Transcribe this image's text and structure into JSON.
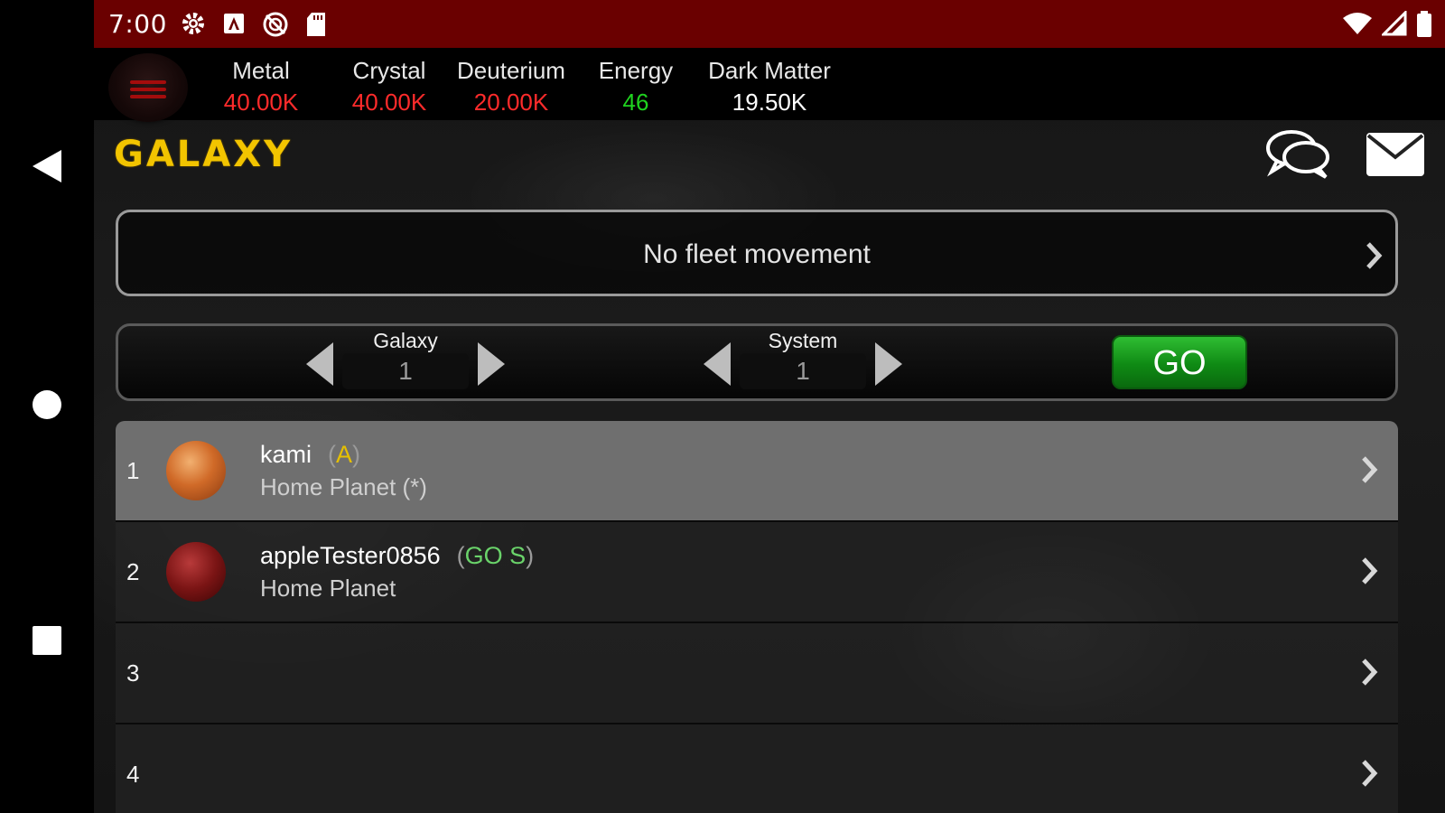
{
  "status_bar": {
    "time": "7:00",
    "left_icons": [
      "gear-icon",
      "a-box-icon",
      "no-sync-icon",
      "sd-card-icon"
    ],
    "right_icons": [
      "wifi-icon",
      "signal-icon",
      "battery-icon"
    ]
  },
  "android_nav": {
    "icons": [
      "back-triangle-icon",
      "home-circle-icon",
      "recents-square-icon"
    ]
  },
  "resources": [
    {
      "label": "Metal",
      "value": "40.00K",
      "color": "#ff2b2b"
    },
    {
      "label": "Crystal",
      "value": "40.00K",
      "color": "#ff2b2b"
    },
    {
      "label": "Deuterium",
      "value": "20.00K",
      "color": "#ff2b2b"
    },
    {
      "label": "Energy",
      "value": "46",
      "color": "#1fd31f"
    },
    {
      "label": "Dark Matter",
      "value": "19.50K",
      "color": "#ffffff"
    }
  ],
  "header": {
    "title": "Galaxy",
    "icons": [
      "chat-icon",
      "mail-icon"
    ],
    "title_color": "#f2c400"
  },
  "fleet": {
    "text": "No fleet movement"
  },
  "navigator": {
    "galaxy_label": "Galaxy",
    "galaxy_value": "1",
    "system_label": "System",
    "system_value": "1",
    "go_label": "GO"
  },
  "positions": [
    {
      "number": "1",
      "player": "kami",
      "tag_open": "(",
      "tag": "A",
      "tag_close": ")",
      "tag_color": "#e6c000",
      "planet": "Home Planet (*)",
      "planet_style": "orange"
    },
    {
      "number": "2",
      "player": "appleTester0856",
      "tag_open": "(",
      "tag": "GO S",
      "tag_close": ")",
      "tag_color": "#6ad36a",
      "planet": "Home Planet",
      "planet_style": "red"
    },
    {
      "number": "3",
      "player": "",
      "tag": "",
      "planet": ""
    },
    {
      "number": "4",
      "player": "",
      "tag": "",
      "planet": ""
    }
  ]
}
